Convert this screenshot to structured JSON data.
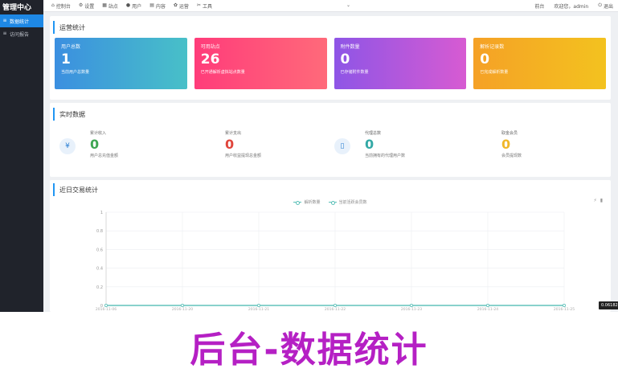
{
  "sidebar": {
    "brand": "管理中心",
    "items": [
      {
        "label": "数据统计",
        "icon": "list-icon",
        "active": true
      },
      {
        "label": "访问报告",
        "icon": "list-icon",
        "active": false
      }
    ]
  },
  "topbar": {
    "nav": [
      {
        "label": "控制台",
        "icon": "home-icon"
      },
      {
        "label": "设置",
        "icon": "gear-icon"
      },
      {
        "label": "站点",
        "icon": "grid-icon"
      },
      {
        "label": "用户",
        "icon": "users-icon"
      },
      {
        "label": "内容",
        "icon": "folder-icon"
      },
      {
        "label": "运营",
        "icon": "settings-icon"
      },
      {
        "label": "工具",
        "icon": "tools-icon"
      }
    ],
    "right": [
      {
        "label": "前台"
      },
      {
        "label": "欢迎您，admin"
      },
      {
        "label": "退出",
        "icon": "power-icon"
      }
    ]
  },
  "overview": {
    "title": "运营统计",
    "cards": [
      {
        "label": "用户总数",
        "value": "1",
        "desc": "当前用户总数量",
        "gradient": [
          "#3b8fe0",
          "#48c0c8"
        ]
      },
      {
        "label": "可用站点",
        "value": "26",
        "desc": "已开通解析虚拟站点数量",
        "gradient": [
          "#ff3c7a",
          "#ff6a7a"
        ]
      },
      {
        "label": "附件数量",
        "value": "0",
        "desc": "已存储附件数量",
        "gradient": [
          "#8e55e6",
          "#d75bd2"
        ]
      },
      {
        "label": "解析记录数",
        "value": "0",
        "desc": "已完成解析数量",
        "gradient": [
          "#f5a126",
          "#f3c21f"
        ]
      }
    ]
  },
  "realtime": {
    "title": "实时数据",
    "items": [
      {
        "label": "累计收入",
        "value": "0",
        "desc": "用户总充值金额",
        "color": "#3fa653",
        "icon": "money-icon"
      },
      {
        "label": "累计支出",
        "value": "0",
        "desc": "用户收益提现总金额",
        "color": "#e0463c",
        "icon": ""
      },
      {
        "label": "代理总数",
        "value": "0",
        "desc": "当前拥有的代理用户数",
        "color": "#34a9a6",
        "icon": "door-icon"
      },
      {
        "label": "取金会员",
        "value": "0",
        "desc": "会员提现数",
        "color": "#f0b72a",
        "icon": ""
      }
    ]
  },
  "chart_section": {
    "title": "近日交易统计",
    "tooltip": "0.06182"
  },
  "chart_data": {
    "type": "line",
    "title": "近日交易统计",
    "x": [
      "2016-11-06",
      "2016-11-20",
      "2016-11-21",
      "2016-11-22",
      "2016-11-23",
      "2016-11-24",
      "2016-11-25"
    ],
    "ylim": [
      0,
      1
    ],
    "yticks": [
      "0",
      "0.2",
      "0.4",
      "0.6",
      "0.8",
      "1"
    ],
    "series": [
      {
        "name": "解析数量",
        "values": [
          0,
          0,
          0,
          0,
          0,
          0,
          0
        ]
      },
      {
        "name": "当前活跃会员数",
        "values": [
          0,
          0,
          0,
          0,
          0,
          0,
          0
        ]
      }
    ],
    "grid": true,
    "legend": "top-center",
    "color": "#5bc0b8"
  },
  "banner": {
    "text": "后台-数据统计"
  }
}
